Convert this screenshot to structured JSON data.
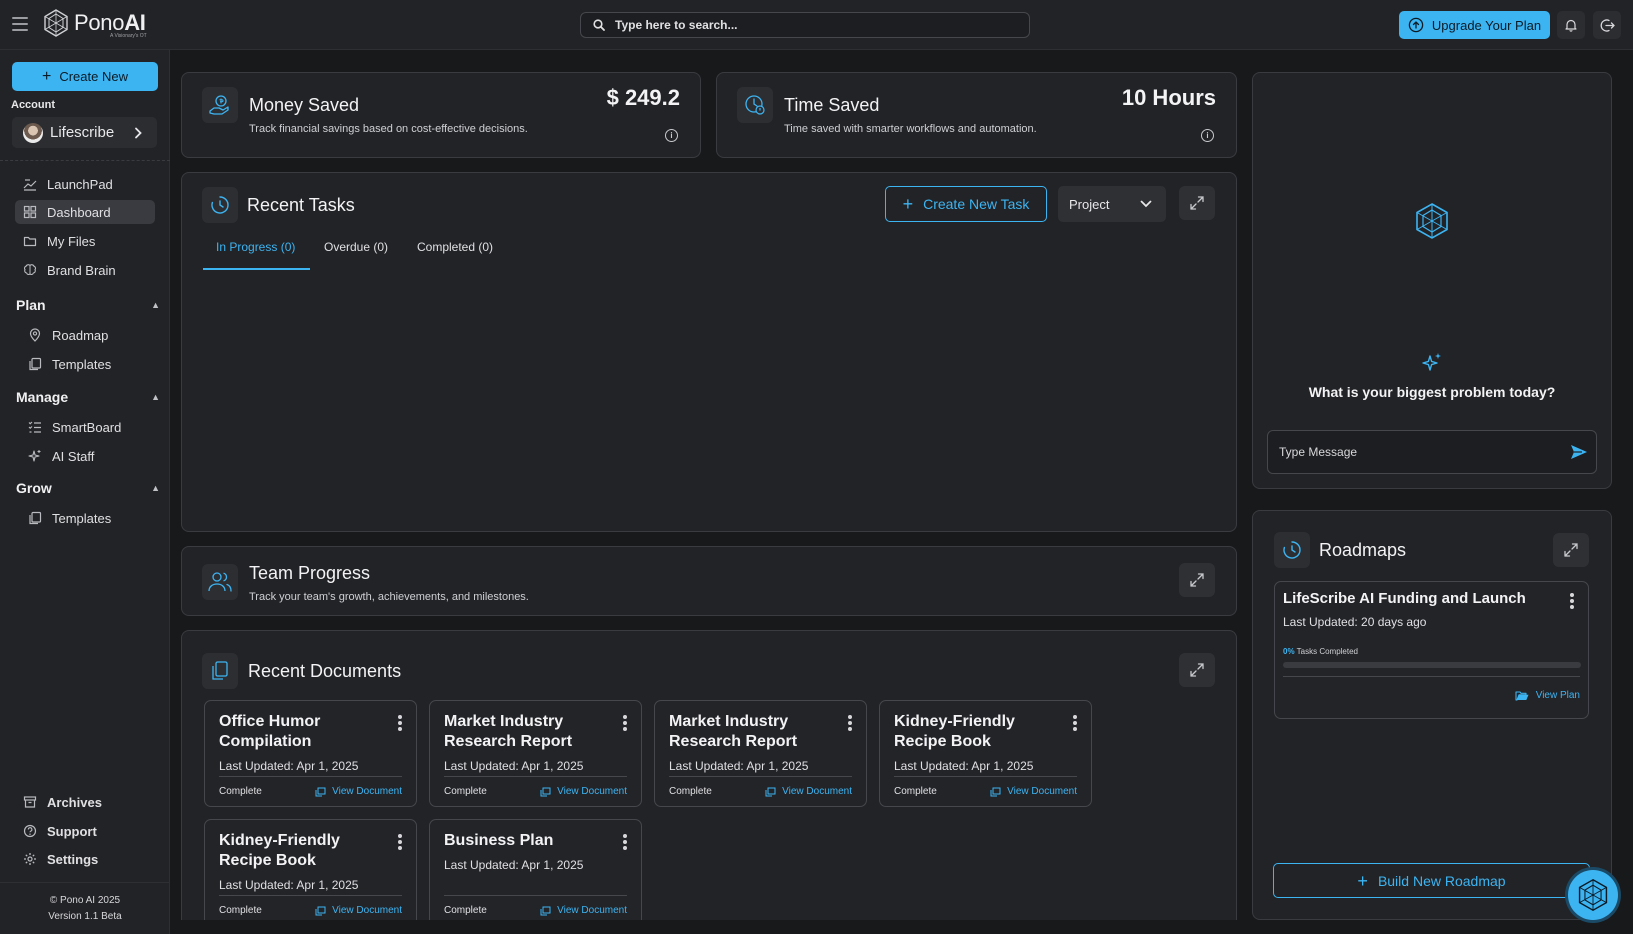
{
  "app": {
    "logo_bold": "Pono",
    "logo_suffix": "AI",
    "logo_sub": "A Visionary's OT"
  },
  "topbar": {
    "search_placeholder": "Type here to search...",
    "upgrade_label": "Upgrade Your Plan",
    "icons": [
      "menu-icon",
      "search-icon",
      "upload-icon",
      "bell-icon",
      "logout-icon"
    ]
  },
  "sidebar": {
    "create_label": "Create New",
    "account_label": "Account",
    "account_name": "Lifescribe",
    "top_items": [
      {
        "label": "LaunchPad",
        "icon": "launchpad-icon"
      },
      {
        "label": "Dashboard",
        "icon": "dashboard-icon",
        "active": true
      },
      {
        "label": "My Files",
        "icon": "folder-icon"
      },
      {
        "label": "Brand Brain",
        "icon": "brain-icon"
      }
    ],
    "sections": [
      {
        "title": "Plan",
        "items": [
          {
            "label": "Roadmap",
            "icon": "pin-icon"
          },
          {
            "label": "Templates",
            "icon": "templates-icon"
          }
        ]
      },
      {
        "title": "Manage",
        "items": [
          {
            "label": "SmartBoard",
            "icon": "checklist-icon"
          },
          {
            "label": "AI Staff",
            "icon": "sparkle-icon"
          }
        ]
      },
      {
        "title": "Grow",
        "items": [
          {
            "label": "Templates",
            "icon": "templates-icon"
          }
        ]
      }
    ],
    "bottom_items": [
      {
        "label": "Archives",
        "icon": "archive-icon"
      },
      {
        "label": "Support",
        "icon": "support-icon"
      },
      {
        "label": "Settings",
        "icon": "gear-icon"
      }
    ],
    "footer_copyright": "© Pono AI 2025",
    "footer_version": "Version 1.1 Beta"
  },
  "money_saved": {
    "title": "Money Saved",
    "desc": "Track financial savings based on cost-effective decisions.",
    "value": "$ 249.2"
  },
  "time_saved": {
    "title": "Time Saved",
    "desc": "Time saved with smarter workflows and automation.",
    "value": "10 Hours"
  },
  "recent_tasks": {
    "title": "Recent Tasks",
    "create_label": "Create New Task",
    "filter_value": "Project",
    "tabs": [
      "In Progress (0)",
      "Overdue (0)",
      "Completed (0)"
    ]
  },
  "team_progress": {
    "title": "Team Progress",
    "desc": "Track your team's growth, achievements, and milestones."
  },
  "recent_documents": {
    "title": "Recent Documents",
    "docs": [
      {
        "title": "Office Humor Compilation",
        "updated": "Last Updated: Apr 1, 2025",
        "status": "Complete",
        "action": "View Document"
      },
      {
        "title": "Market Industry Research Report",
        "updated": "Last Updated: Apr 1, 2025",
        "status": "Complete",
        "action": "View Document"
      },
      {
        "title": "Market Industry Research Report",
        "updated": "Last Updated: Apr 1, 2025",
        "status": "Complete",
        "action": "View Document"
      },
      {
        "title": "Kidney-Friendly Recipe Book",
        "updated": "Last Updated: Apr 1, 2025",
        "status": "Complete",
        "action": "View Document"
      },
      {
        "title": "Kidney-Friendly Recipe Book",
        "updated": "Last Updated: Apr 1, 2025",
        "status": "Complete",
        "action": "View Document"
      },
      {
        "title": "Business Plan",
        "updated": "Last Updated: Apr 1, 2025",
        "status": "Complete",
        "action": "View Document"
      }
    ]
  },
  "assistant": {
    "question": "What is your biggest problem today?",
    "input_placeholder": "Type Message"
  },
  "roadmaps": {
    "title": "Roadmaps",
    "item_title": "LifeScribe AI Funding and Launch",
    "item_updated": "Last Updated: 20 days ago",
    "progress_pct_label": "0%",
    "progress_label": "Tasks Completed",
    "progress": 0,
    "view_label": "View Plan",
    "build_label": "Build New Roadmap"
  },
  "colors": {
    "accent": "#3db4f2",
    "background": "#18191b",
    "card": "#222326"
  }
}
